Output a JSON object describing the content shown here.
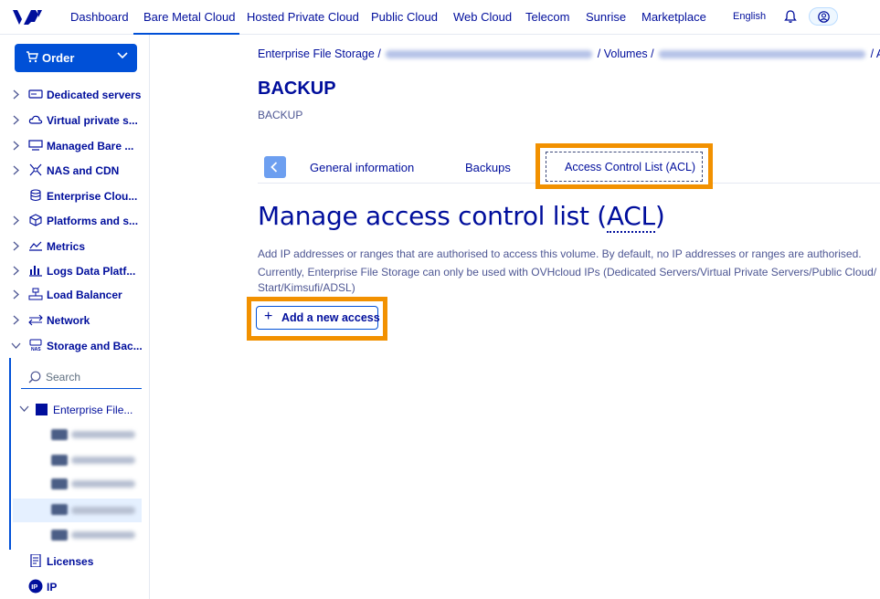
{
  "topnav": {
    "items": [
      "Dashboard",
      "Bare Metal Cloud",
      "Hosted Private Cloud",
      "Public Cloud",
      "Web Cloud",
      "Telecom",
      "Sunrise",
      "Marketplace"
    ],
    "active": "Bare Metal Cloud",
    "language": "English"
  },
  "sidebar": {
    "order_label": "Order",
    "items": [
      {
        "label": "Dedicated servers",
        "icon": "server-icon"
      },
      {
        "label": "Virtual private s...",
        "icon": "cloud-icon"
      },
      {
        "label": "Managed Bare ...",
        "icon": "managed-server-icon"
      },
      {
        "label": "NAS and CDN",
        "icon": "network-nodes-icon"
      },
      {
        "label": "Enterprise Clou...",
        "icon": "database-icon"
      },
      {
        "label": "Platforms and s...",
        "icon": "cubes-icon"
      },
      {
        "label": "Metrics",
        "icon": "metrics-icon"
      },
      {
        "label": "Logs Data Platf...",
        "icon": "logs-chart-icon"
      },
      {
        "label": "Load Balancer",
        "icon": "load-balancer-icon"
      },
      {
        "label": "Network",
        "icon": "network-arrows-icon"
      },
      {
        "label": "Storage and Bac...",
        "icon": "nas-icon"
      }
    ],
    "search_placeholder": "Search",
    "efs_label": "Enterprise File...",
    "bottom_items": [
      {
        "label": "Licenses",
        "icon": "license-icon"
      },
      {
        "label": "IP",
        "icon": "ip-icon"
      }
    ]
  },
  "main": {
    "breadcrumb": {
      "first": "Enterprise File Storage",
      "second": "Volumes",
      "last": "AC"
    },
    "title": "BACKUP",
    "subtitle": "BACKUP",
    "tabs": [
      "General information",
      "Backups",
      "Access Control List (ACL)"
    ],
    "heading_prefix": "Manage access control list (",
    "heading_abbr": "ACL",
    "heading_suffix": ")",
    "desc_line1": "Add IP addresses or ranges that are authorised to access this volume. By default, no IP addresses or ranges are authorised.",
    "desc_line2": "Currently, Enterprise File Storage can only be used with OVHcloud IPs (Dedicated Servers/Virtual Private Servers/Public Cloud/",
    "desc_line3": "Start/Kimsufi/ADSL)",
    "add_button": "Add a new access"
  },
  "colors": {
    "brand": "#000e9c",
    "primary": "#0050d7",
    "highlight": "#f29100"
  }
}
